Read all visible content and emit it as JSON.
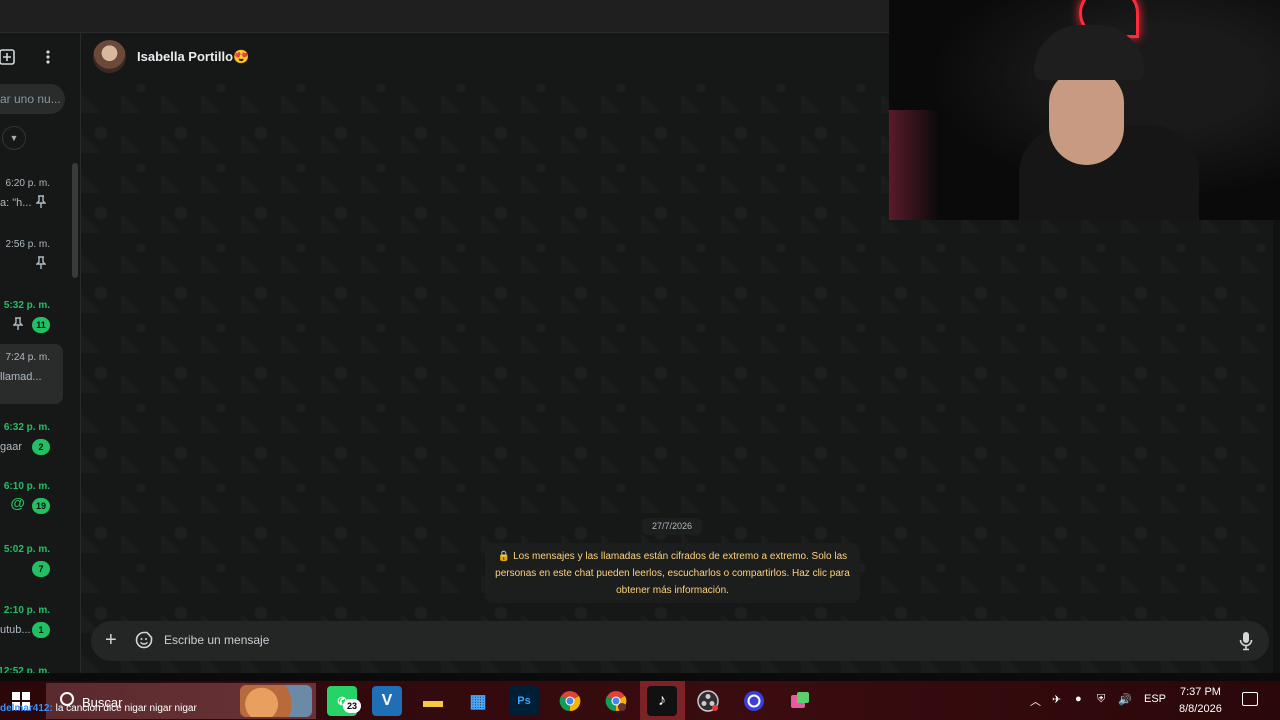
{
  "sidebar": {
    "search_placeholder": "ar uno nu...",
    "chats": [
      {
        "time": "6:20 p. m.",
        "preview": "a: \"h...",
        "pinned": true,
        "unread": false,
        "badge": ""
      },
      {
        "time": "2:56 p. m.",
        "preview": "",
        "pinned": true,
        "unread": false,
        "badge": ""
      },
      {
        "time": "5:32 p. m.",
        "preview": "",
        "pinned": true,
        "unread": true,
        "badge": "11"
      },
      {
        "time": "7:24 p. m.",
        "preview": "llamad...",
        "pinned": false,
        "unread": false,
        "badge": "",
        "selected": true
      },
      {
        "time": "6:32 p. m.",
        "preview": "gaar",
        "pinned": false,
        "unread": true,
        "badge": "2"
      },
      {
        "time": "6:10 p. m.",
        "preview": "",
        "pinned": false,
        "unread": true,
        "badge": "19",
        "mention": "@"
      },
      {
        "time": "5:02 p. m.",
        "preview": "",
        "pinned": false,
        "unread": true,
        "badge": "7"
      },
      {
        "time": "2:10 p. m.",
        "preview": "utub...",
        "pinned": false,
        "unread": true,
        "badge": "1"
      },
      {
        "time": "12:52 p. m.",
        "preview": "",
        "pinned": false,
        "unread": true,
        "badge": ""
      }
    ]
  },
  "chat": {
    "contact_name": "Isabella Portillo😍",
    "date_chip": "27/7/2026",
    "encryption_notice": "🔒 Los mensajes y las llamadas están cifrados de extremo a extremo. Solo las personas en este chat pueden leerlos, escucharlos o compartirlos. Haz clic para obtener más información.",
    "composer_placeholder": "Escribe un mensaje"
  },
  "taskbar": {
    "search_label": "Buscar",
    "whatsapp_badge": "23",
    "language": "ESP",
    "time": "7:37 PM",
    "date": "8/8/2026",
    "apps": [
      "whatsapp-icon",
      "v-app-icon",
      "file-explorer-icon",
      "store-icon",
      "photoshop-icon",
      "chrome-icon",
      "chrome-profile-icon",
      "tiktok-icon",
      "obs-icon",
      "app-circle-icon",
      "app-game-icon"
    ]
  },
  "stream_chat": {
    "user": "delmar412:",
    "message": " la cancion dice nigar nigar nigar"
  },
  "colors": {
    "accent_green": "#21c063",
    "notice_yellow": "#ffd279",
    "chat_bg": "#161717",
    "taskbar_red": "#3a0c10"
  }
}
